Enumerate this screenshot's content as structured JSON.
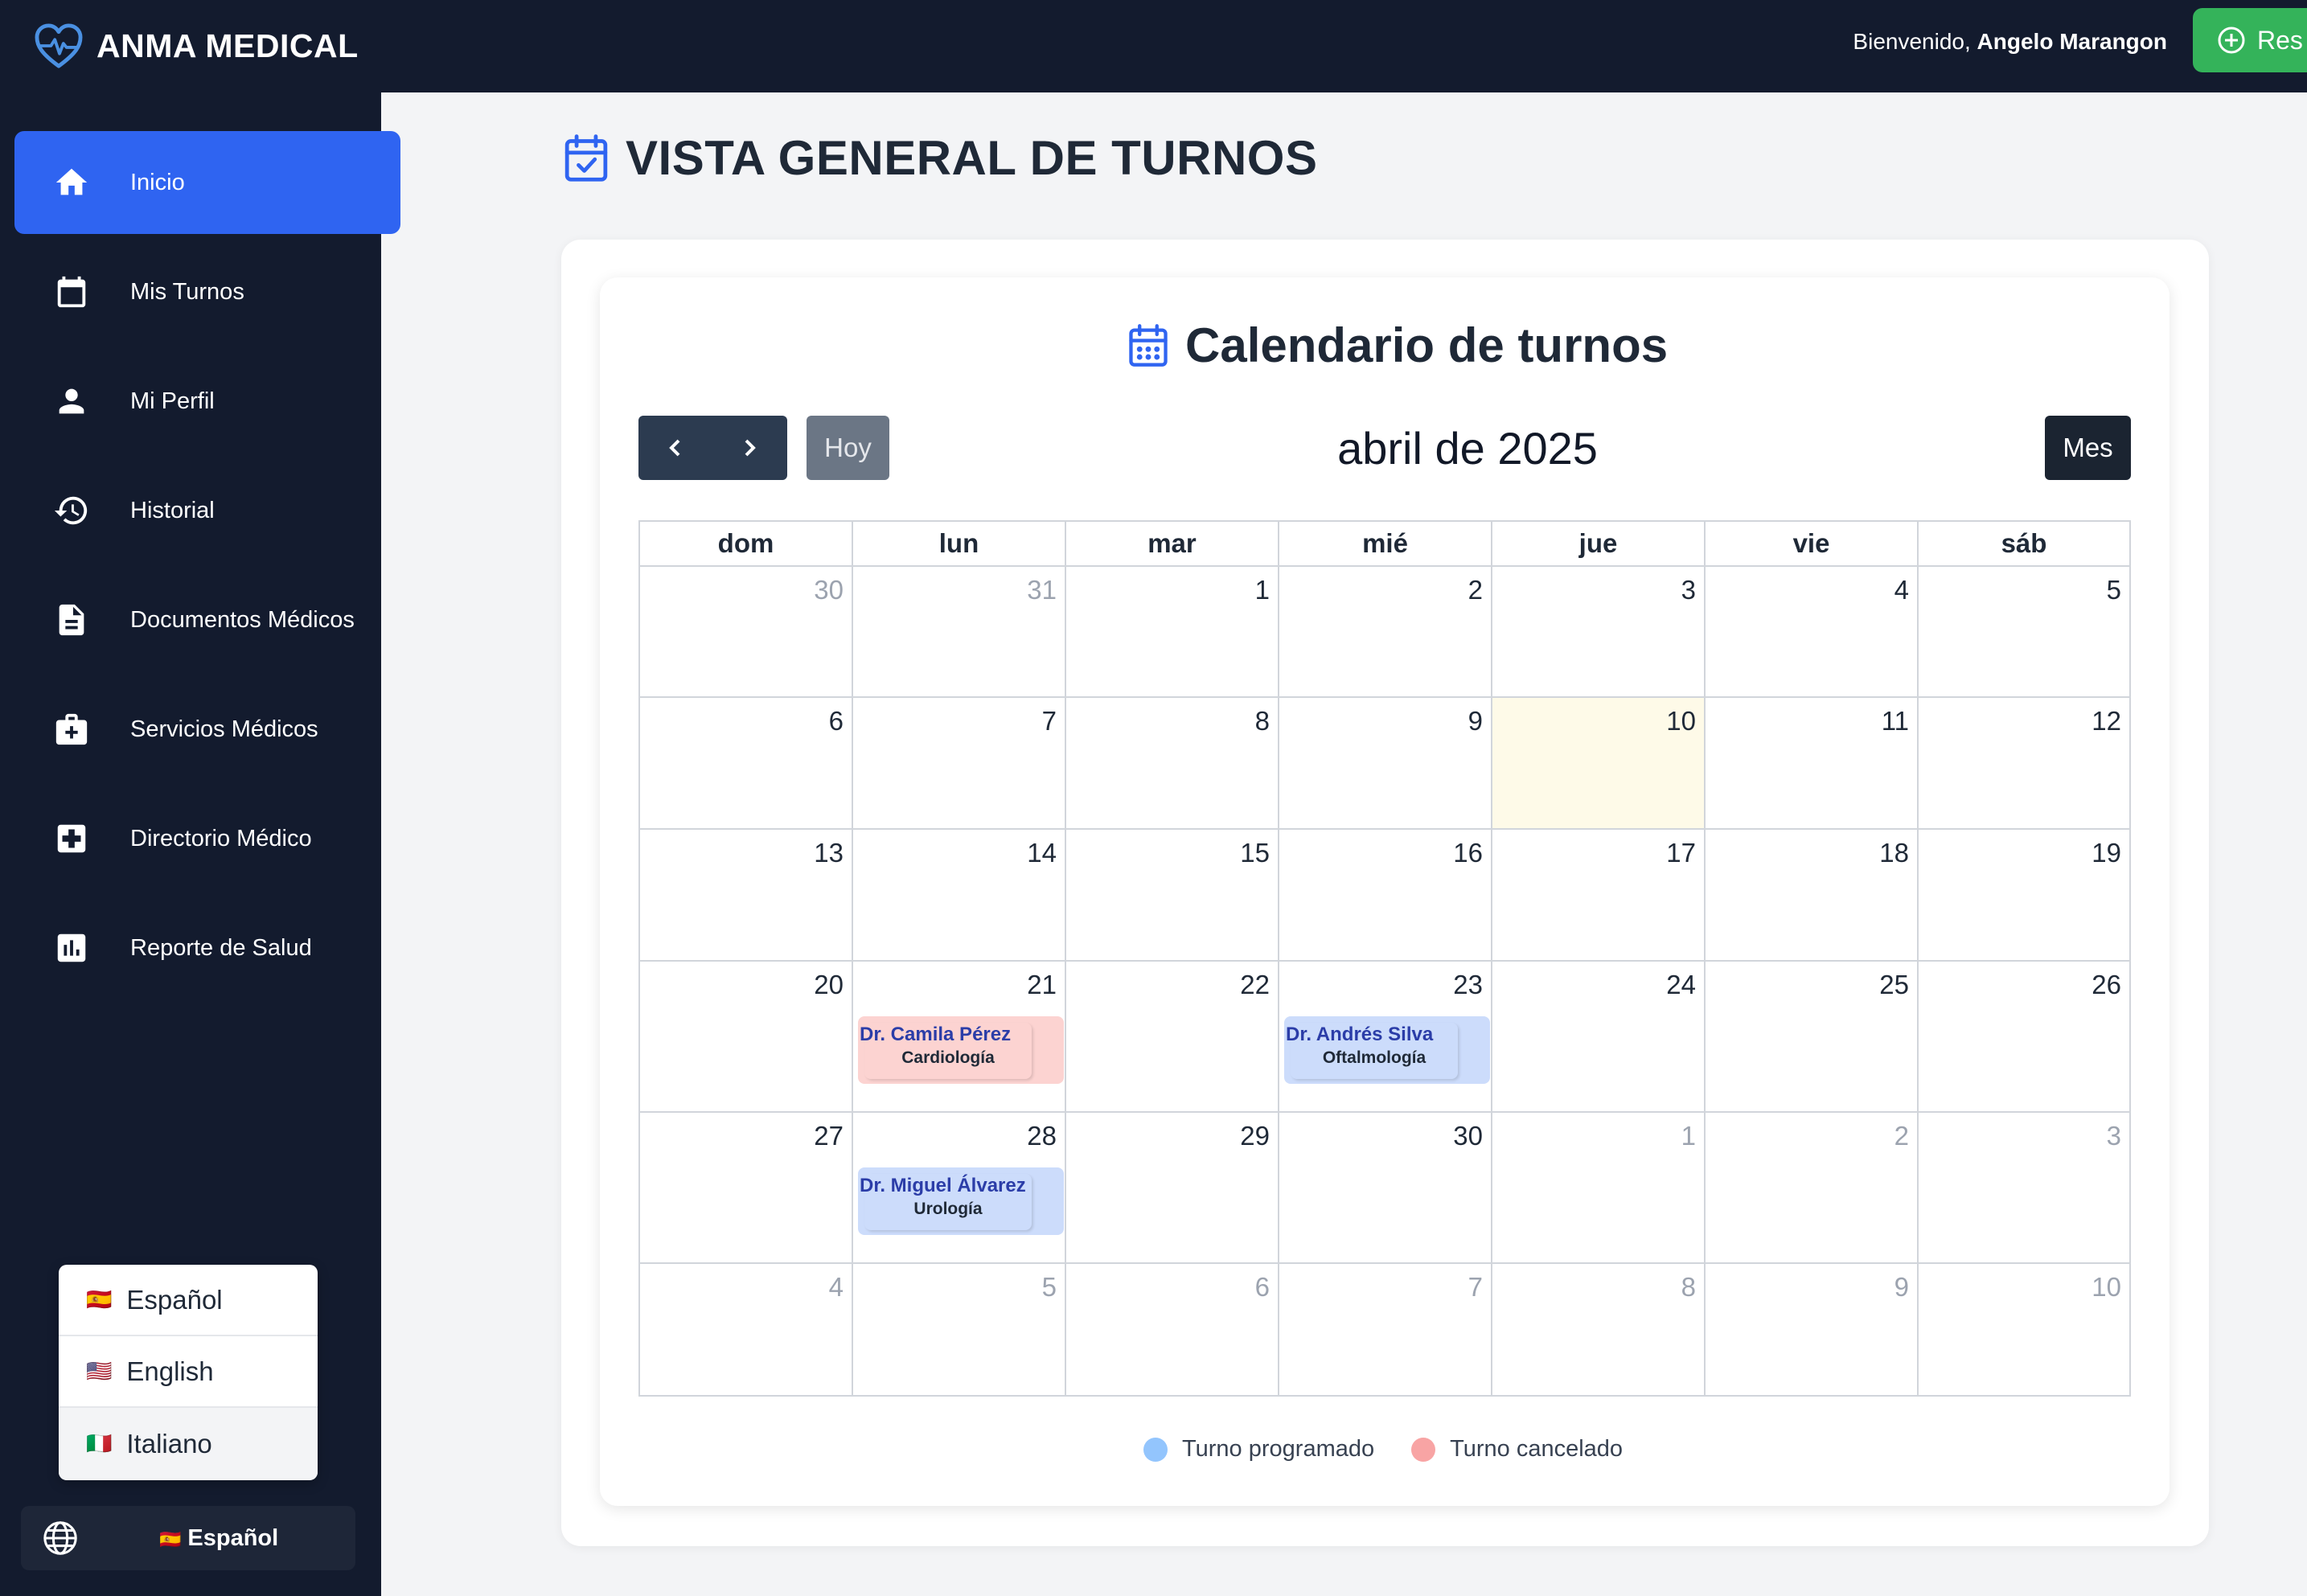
{
  "header": {
    "brand": "ANMA MEDICAL",
    "welcome_prefix": "Bienvenido,",
    "user_name": "Angelo Marangon",
    "reserve_label": "Res"
  },
  "sidebar": {
    "items": [
      {
        "label": "Inicio",
        "icon": "home-icon",
        "active": true
      },
      {
        "label": "Mis Turnos",
        "icon": "calendar-icon"
      },
      {
        "label": "Mi Perfil",
        "icon": "person-icon"
      },
      {
        "label": "Historial",
        "icon": "history-icon"
      },
      {
        "label": "Documentos Médicos",
        "icon": "document-icon"
      },
      {
        "label": "Servicios Médicos",
        "icon": "medical-bag-icon"
      },
      {
        "label": "Directorio Médico",
        "icon": "medical-cross-icon"
      },
      {
        "label": "Reporte de Salud",
        "icon": "bar-chart-icon"
      }
    ]
  },
  "language": {
    "options": [
      {
        "flag": "🇪🇸",
        "label": "Español"
      },
      {
        "flag": "🇺🇸",
        "label": "English"
      },
      {
        "flag": "🇮🇹",
        "label": "Italiano"
      }
    ],
    "current_flag": "🇪🇸",
    "current": "Español"
  },
  "page": {
    "title": "VISTA GENERAL DE TURNOS"
  },
  "calendar": {
    "title": "Calendario de turnos",
    "today_label": "Hoy",
    "month_label": "abril de 2025",
    "view_label": "Mes",
    "weekdays": [
      "dom",
      "lun",
      "mar",
      "mié",
      "jue",
      "vie",
      "sáb"
    ],
    "weeks": [
      [
        30,
        31,
        1,
        2,
        3,
        4,
        5
      ],
      [
        6,
        7,
        8,
        9,
        10,
        11,
        12
      ],
      [
        13,
        14,
        15,
        16,
        17,
        18,
        19
      ],
      [
        20,
        21,
        22,
        23,
        24,
        25,
        26
      ],
      [
        27,
        28,
        29,
        30,
        1,
        2,
        3
      ],
      [
        4,
        5,
        6,
        7,
        8,
        9,
        10
      ]
    ],
    "today": 10,
    "events": [
      {
        "week": 3,
        "day": 1,
        "doctor": "Dr. Camila Pérez",
        "specialty": "Cardiología",
        "status": "cancelado"
      },
      {
        "week": 3,
        "day": 3,
        "doctor": "Dr. Andrés Silva",
        "specialty": "Oftalmología",
        "status": "programado"
      },
      {
        "week": 4,
        "day": 1,
        "doctor": "Dr. Miguel Álvarez",
        "specialty": "Urología",
        "status": "programado"
      }
    ],
    "legend": [
      {
        "label": "Turno programado",
        "color": "#93c5fd"
      },
      {
        "label": "Turno cancelado",
        "color": "#f8a4a4"
      }
    ]
  }
}
